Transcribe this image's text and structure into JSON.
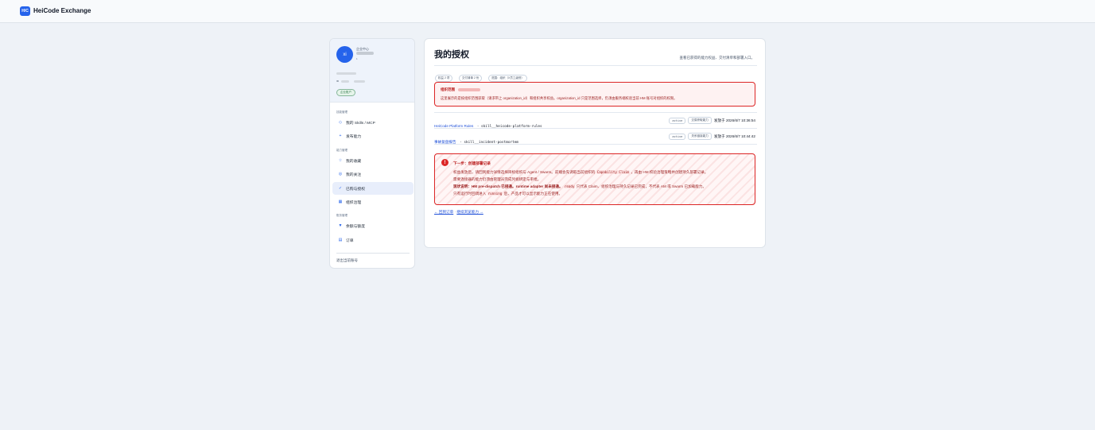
{
  "app": {
    "logo_text": "H/C",
    "name": "HeiCode Exchange"
  },
  "sidebar": {
    "avatar_initials": "xi",
    "profile_title": "企业中心",
    "profile_sub": "1",
    "id_prefix": "ID",
    "badge": "企业账户",
    "sections": {
      "skills": "技能管理",
      "abilities": "能力管理",
      "billing": "账务管理"
    },
    "items": {
      "my_skills": {
        "icon": "◇",
        "label": "我的 Skills / MCP"
      },
      "publish": {
        "icon": "+",
        "label": "发布能力"
      },
      "favorites": {
        "icon": "☆",
        "label": "我的收藏"
      },
      "follows": {
        "icon": "◎",
        "label": "我的关注"
      },
      "purchased": {
        "icon": "✓",
        "label": "已购与授权"
      },
      "org_governance": {
        "icon": "▦",
        "label": "组织治理"
      },
      "quota": {
        "icon": "▼",
        "label": "余额与额度"
      },
      "orders": {
        "icon": "▤",
        "label": "订单"
      }
    },
    "logout": "退出当前账号"
  },
  "main": {
    "title": "我的授权",
    "subtitle": "查看已获得的能力权益、交付清单和部署入口。",
    "chips": [
      "权益 2 项",
      "交付清单 2 份",
      "范围：组织（X员工级别）"
    ],
    "scope_alert": {
      "title": "组织范围",
      "text": "这里展示的是按组织范围获取（请求带上 organization_id）和组织共享权益。organization_id 只是范围选择，仍须由服务端校验当前 HM 账号对组织的权限。"
    },
    "rows": [
      {
        "link": "HeiCode Platform Rules",
        "sep": " · ",
        "slug": "skill__heicode-platform-rules",
        "status": "active",
        "tag": "交易获取能力",
        "date": "发放于 2026/6/7 10:36:54"
      },
      {
        "link": "事故复盘报告",
        "sep": " · ",
        "slug": "skill__incident-postmortem",
        "status": "active",
        "tag": "关系链接能力",
        "date": "发放于 2026/6/7 10:44:42"
      }
    ],
    "next_step": {
      "icon": "!",
      "title": "下一步：创建部署记录",
      "l1_a": "权益发放后，请回到能力详情选择目标组织与 Agent / Swarm。前端会先调取当前组织的",
      "l1_code": "Capability Claim",
      "l1_b": "，再由 HM 校验治理策略并创建持久部署记录。",
      "l2": "需要连接器的能力仍须由管理员完成凭据绑定与审批。",
      "l3_bold": "现状说明：HM pre-dispatch 已接通。runtime adapter 尚未接通。",
      "l3_code": "ready",
      "l3_b": "只代表 Claim、组织治理与持久记录已完成，不代表 AM 或 Swarm 已加载能力。",
      "l4_a": "只有运行时回调进入",
      "l4_code": "running",
      "l4_b": "后，产品才可以显示能力正在使用。"
    },
    "links": {
      "back": "← 回到订单",
      "sep": " · ",
      "browse": "继续浏览能力 →"
    }
  }
}
